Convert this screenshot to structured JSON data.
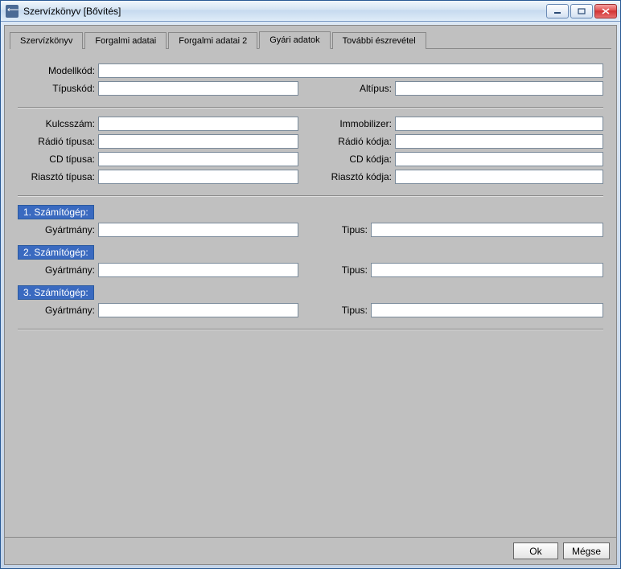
{
  "window": {
    "title": "Szervízkönyv [Bővítés]"
  },
  "tabs": {
    "t0": "Szervízkönyv",
    "t1": "Forgalmi adatai",
    "t2": "Forgalmi adatai 2",
    "t3": "Gyári adatok",
    "t4": "További észrevétel"
  },
  "labels": {
    "modelkod": "Modellkód:",
    "tipuskod": "Típuskód:",
    "altipus": "Altípus:",
    "kulcsszam": "Kulcsszám:",
    "immobilizer": "Immobilizer:",
    "radio_tipusa": "Rádió típusa:",
    "radio_kodja": "Rádió kódja:",
    "cd_tipusa": "CD típusa:",
    "cd_kodja": "CD kódja:",
    "riaszto_tipusa": "Riasztó típusa:",
    "riaszto_kodja": "Riasztó kódja:",
    "gyartmany": "Gyártmány:",
    "tipus": "Tipus:"
  },
  "groups": {
    "c1": "1. Számítógép:",
    "c2": "2. Számítógép:",
    "c3": "3. Számítógép:"
  },
  "values": {
    "modelkod": "",
    "tipuskod": "",
    "altipus": "",
    "kulcsszam": "",
    "immobilizer": "",
    "radio_tipusa": "",
    "radio_kodja": "",
    "cd_tipusa": "",
    "cd_kodja": "",
    "riaszto_tipusa": "",
    "riaszto_kodja": "",
    "c1_gyartmany": "",
    "c1_tipus": "",
    "c2_gyartmany": "",
    "c2_tipus": "",
    "c3_gyartmany": "",
    "c3_tipus": ""
  },
  "buttons": {
    "ok": "Ok",
    "cancel": "Mégse"
  }
}
